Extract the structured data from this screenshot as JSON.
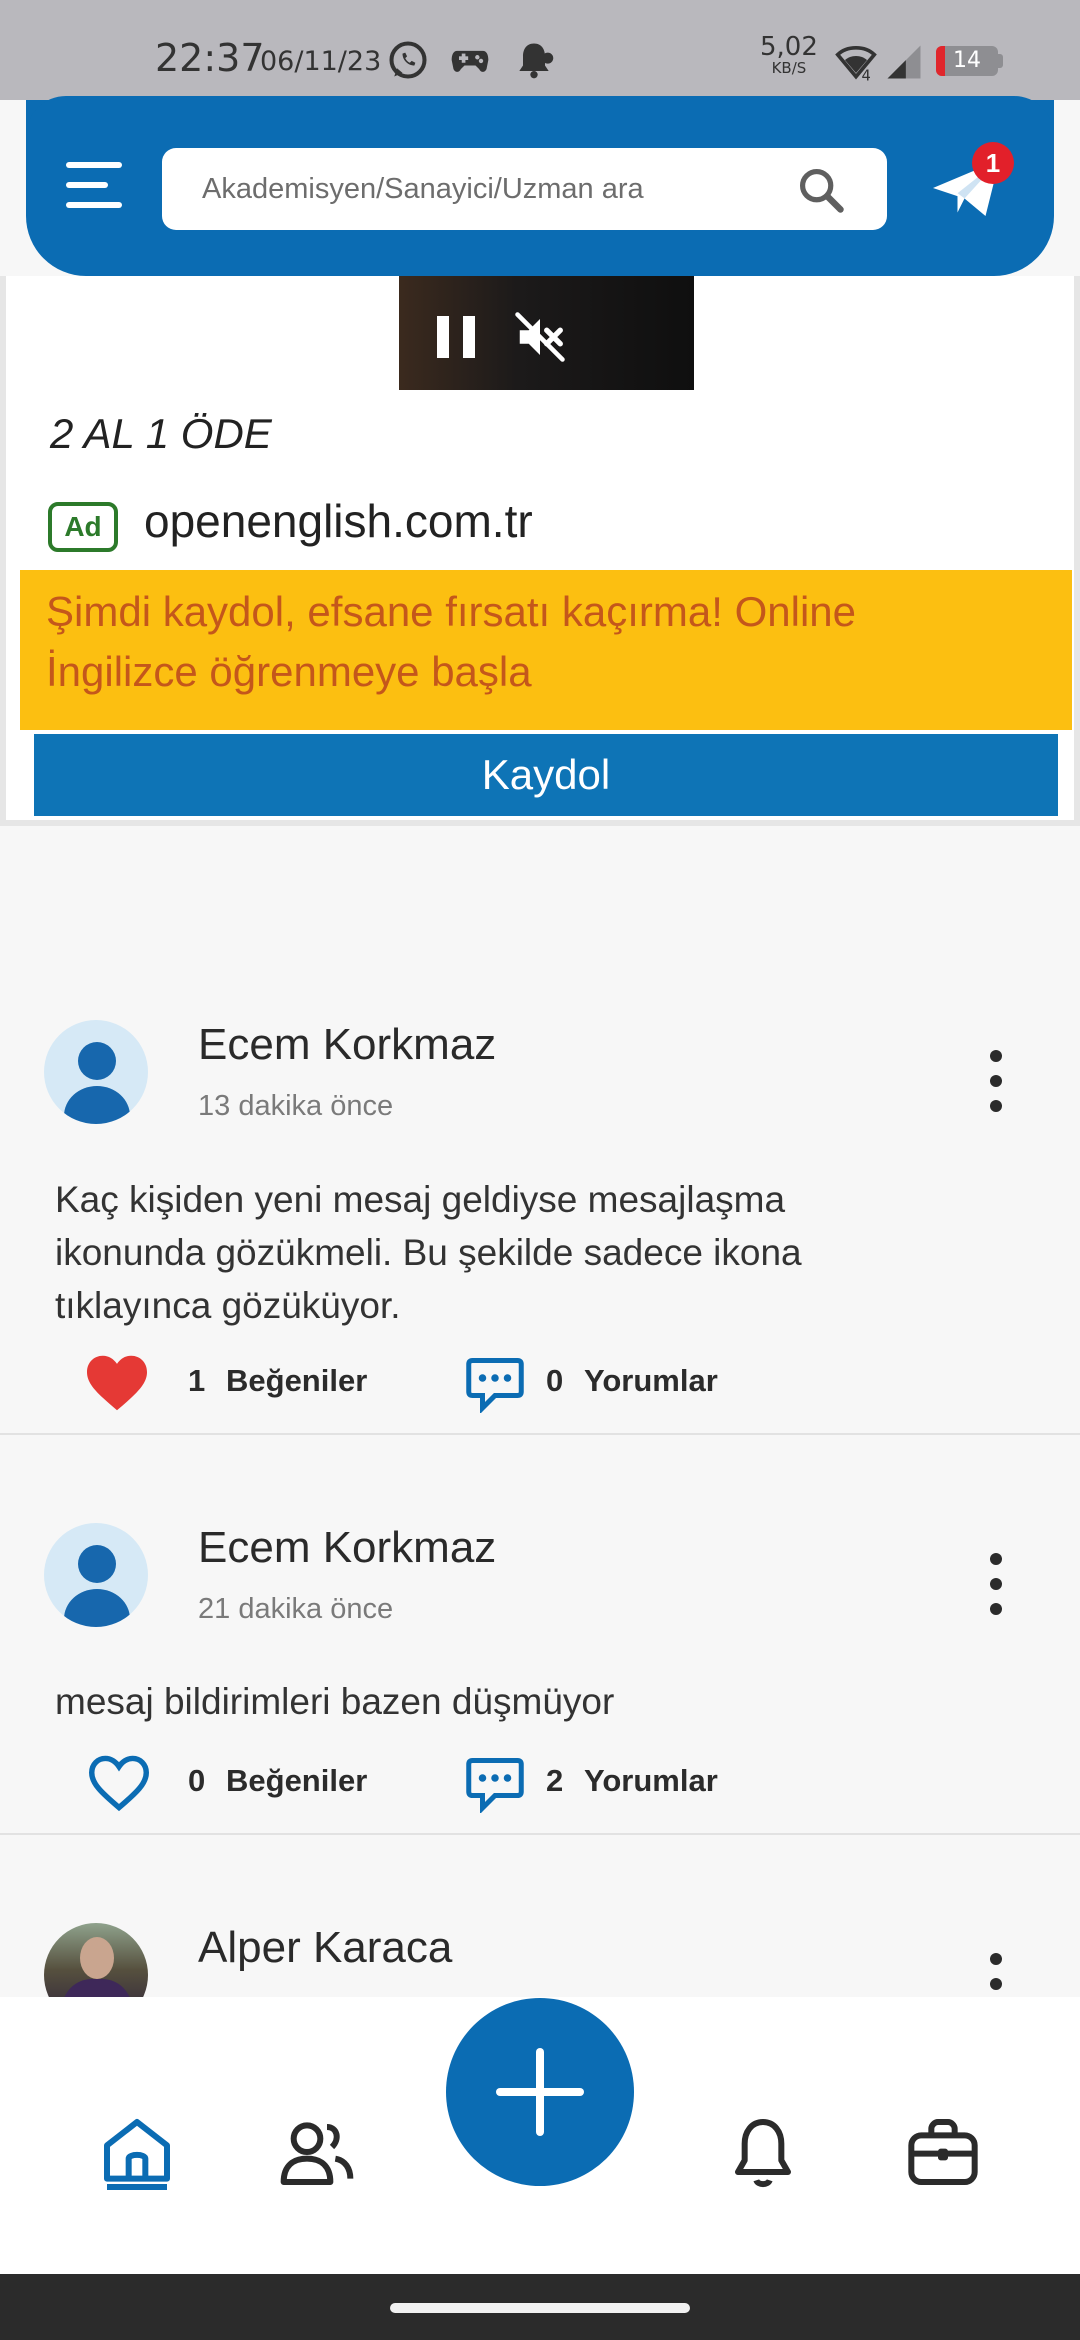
{
  "status_bar": {
    "time": "22:37",
    "date": "06/11/23",
    "speed_value": "5,02",
    "speed_unit": "KB/S",
    "battery": "14",
    "battery_level": 0.14
  },
  "header": {
    "search_placeholder": "Akademisyen/Sanayici/Uzman ara",
    "message_badge": "1"
  },
  "ad": {
    "headline": "2 AL 1 ÖDE",
    "tag": "Ad",
    "domain": "openenglish.com.tr",
    "banner_line1": "Şimdi kaydol, efsane fırsatı kaçırma! Online",
    "banner_line2": "İngilizce öğrenmeye başla",
    "cta": "Kaydol"
  },
  "posts": [
    {
      "author": "Ecem Korkmaz",
      "time": "13 dakika önce",
      "text_line1": "Kaç kişiden yeni mesaj geldiyse mesajlaşma",
      "text_line2": "ikonunda gözükmeli. Bu şekilde sadece ikona",
      "text_line3": "tıklayınca gözüküyor.",
      "likes": "1",
      "likes_label": "Beğeniler",
      "liked": true,
      "comments": "0",
      "comments_label": "Yorumlar"
    },
    {
      "author": "Ecem Korkmaz",
      "time": "21 dakika önce",
      "text_line1": "mesaj bildirimleri bazen düşmüyor",
      "likes": "0",
      "likes_label": "Beğeniler",
      "liked": false,
      "comments": "2",
      "comments_label": "Yorumlar"
    },
    {
      "author": "Alper Karaca"
    }
  ],
  "colors": {
    "primary": "#0b6cb3",
    "ad_banner": "#fcbf11",
    "ad_banner_text": "#c4571b",
    "like_red": "#e53935",
    "badge_red": "#e2202a"
  },
  "icons": {
    "menu": "menu-icon",
    "search": "search-icon",
    "send": "paper-plane-icon",
    "pause": "pause-icon",
    "mute": "mute-icon",
    "like": "heart-icon",
    "comment": "comment-bubble-icon",
    "more": "more-vertical-icon",
    "home": "home-icon",
    "people": "people-icon",
    "add": "plus-icon",
    "notifications": "bell-icon",
    "jobs": "briefcase-icon"
  }
}
